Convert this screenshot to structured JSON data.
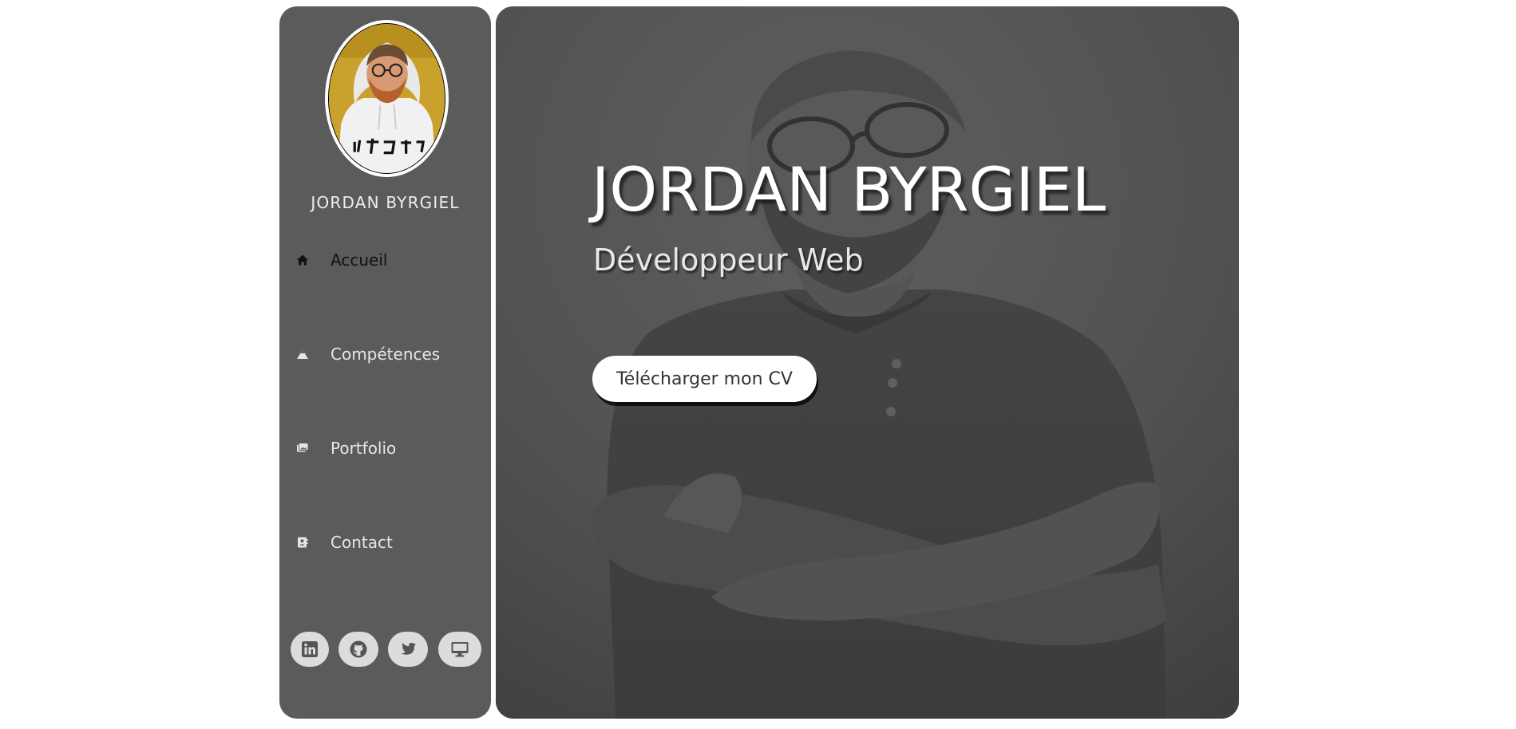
{
  "sidebar": {
    "name": "JORDAN BYRGIEL",
    "avatar": {
      "shirt_text": "ピカチュウ"
    },
    "nav": [
      {
        "label": "Accueil",
        "icon": "home-icon",
        "active": true
      },
      {
        "label": "Compétences",
        "icon": "mountain-icon",
        "active": false
      },
      {
        "label": "Portfolio",
        "icon": "images-icon",
        "active": false
      },
      {
        "label": "Contact",
        "icon": "contact-card-icon",
        "active": false
      }
    ],
    "socials": [
      {
        "name": "linkedin",
        "icon": "linkedin-icon"
      },
      {
        "name": "github",
        "icon": "github-icon"
      },
      {
        "name": "twitter",
        "icon": "twitter-icon"
      },
      {
        "name": "portfolio-site",
        "icon": "desktop-icon"
      }
    ]
  },
  "hero": {
    "title": "JORDAN BYRGIEL",
    "subtitle": "Développeur Web",
    "cv_button_label": "Télécharger mon CV"
  },
  "colors": {
    "sidebar_bg": "#5b5b5b",
    "hero_bg": "#555555",
    "social_bg": "#dcdcdc",
    "button_bg": "#ffffff",
    "active_nav_text": "#111111",
    "nav_text": "#e6e6e6"
  }
}
